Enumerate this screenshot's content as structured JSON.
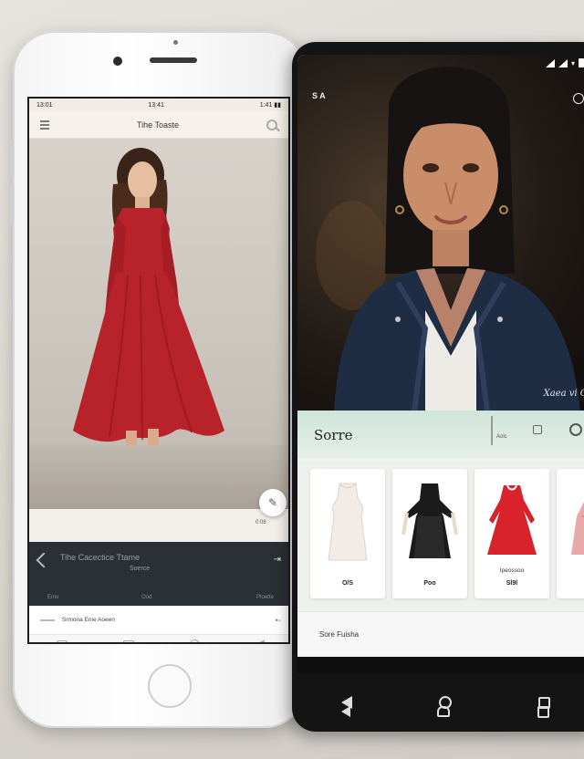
{
  "left_phone": {
    "status": {
      "left": "13:01",
      "center": "13:41",
      "right": "1:41 ▮▮"
    },
    "header": {
      "title": "Tihe Toaste"
    },
    "hero": {
      "share_label": "0:08"
    },
    "dark_bar": {
      "title": "Tihe Cacectice Ttame",
      "subtitle": "Soerce",
      "labels": [
        "Emo",
        "Ood",
        "Ptoette"
      ]
    },
    "search_row": {
      "text": "Srmona Enie Aoeen"
    }
  },
  "right_phone": {
    "status": {
      "icons": [
        "signal",
        "signal",
        "wifi",
        "battery"
      ]
    },
    "hero": {
      "logo": "S A",
      "caption": "Xaea vi O"
    },
    "category_bar": {
      "title": "Sorre",
      "label": "Aolc"
    },
    "products": [
      {
        "name": "",
        "price": "O/S",
        "color": "#f3ece6"
      },
      {
        "name": "",
        "price": "Poo",
        "color": "#1a1a1a"
      },
      {
        "name": "Ipeossoo",
        "price": "Sl9l",
        "color": "#d8232a"
      },
      {
        "name": "",
        "price": "",
        "color": "#e8a9a9"
      }
    ],
    "footer": {
      "text": "Sore Fuisha"
    }
  },
  "accents": {
    "dress_red": "#b8232b",
    "jacket_navy": "#1f2d44",
    "mint": "#cfe5d9"
  }
}
